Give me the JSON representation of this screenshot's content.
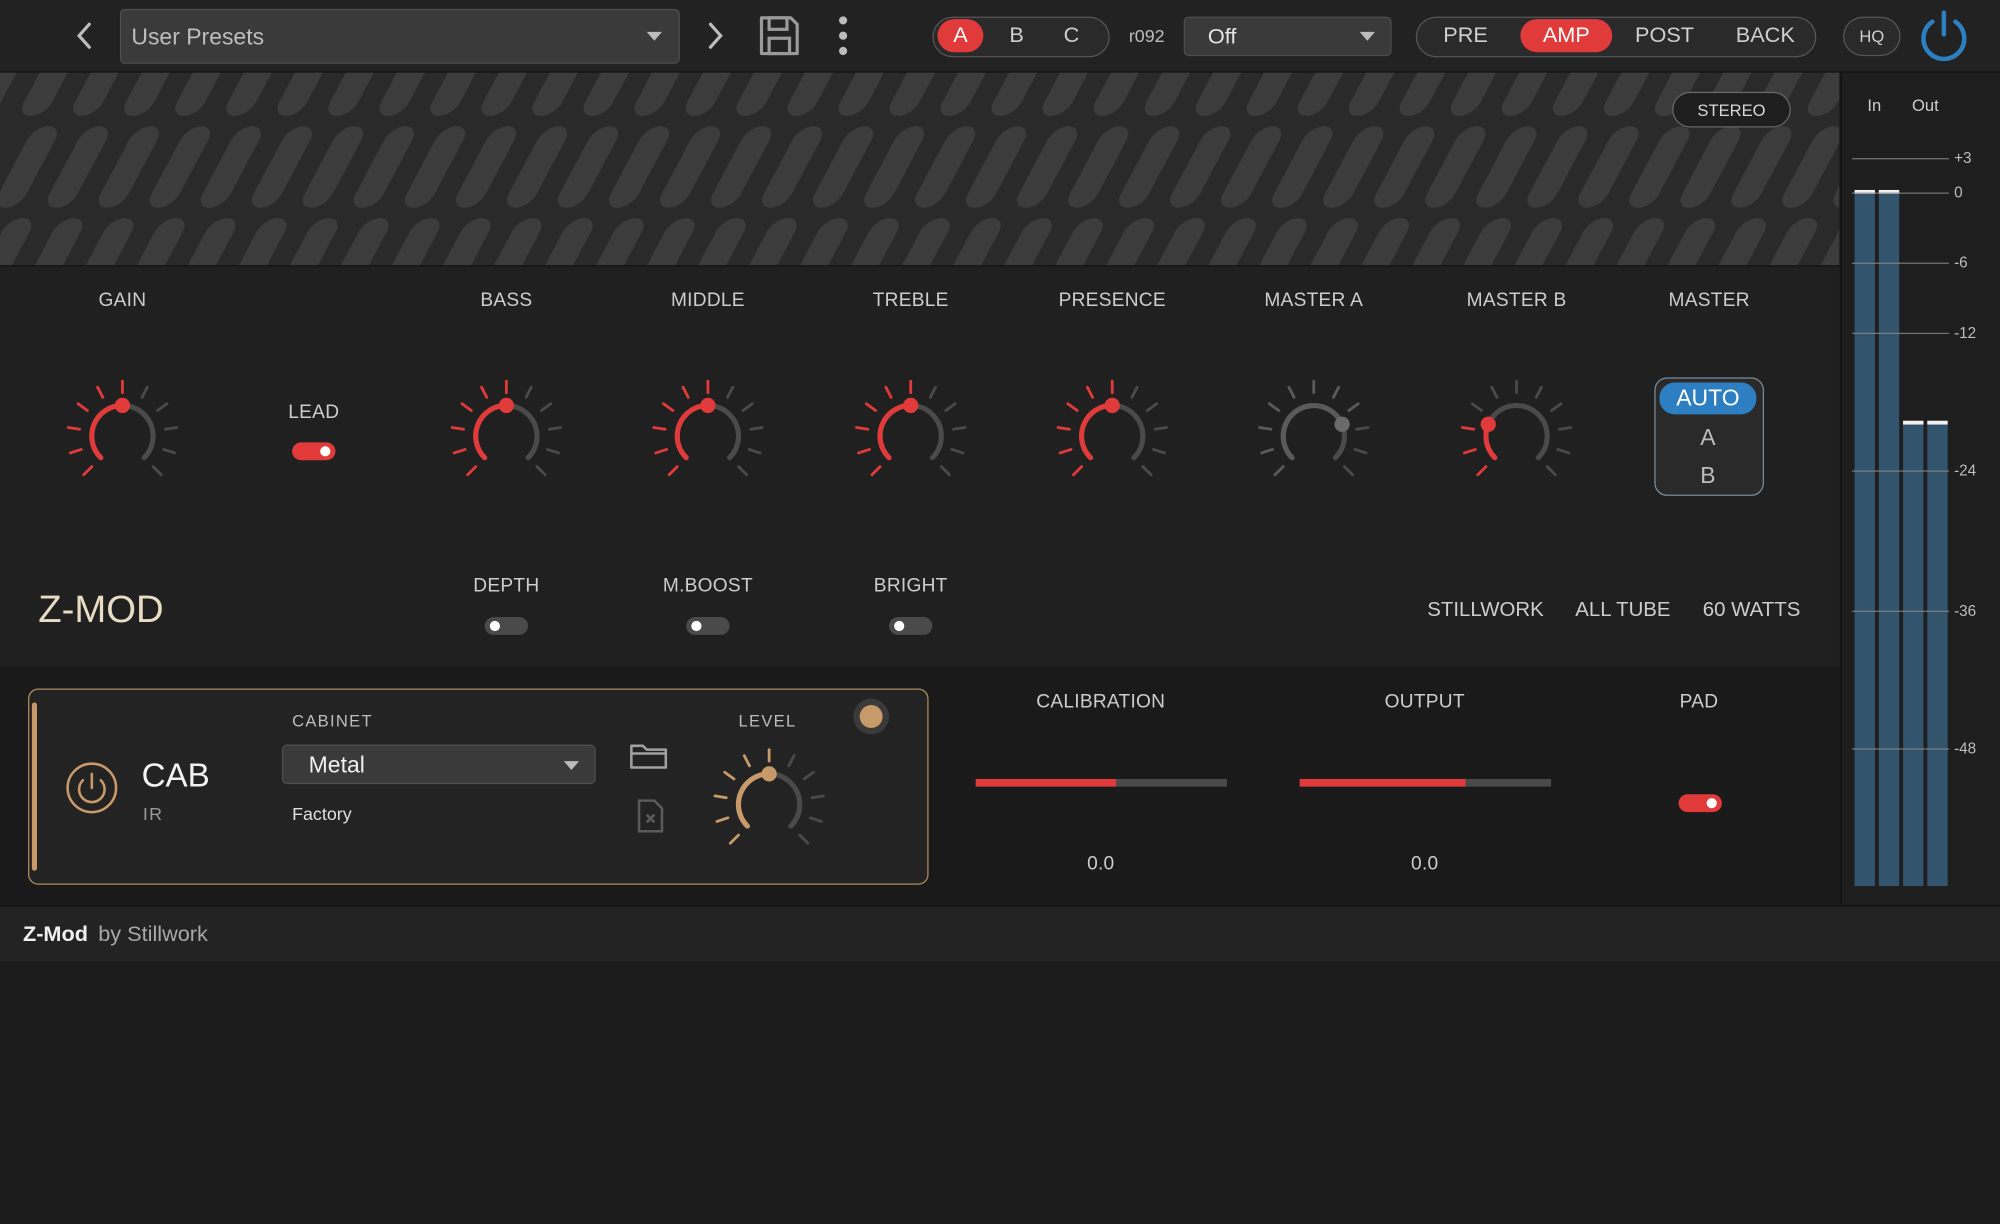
{
  "colors": {
    "accent_red": "#e03a3a",
    "accent_blue": "#2d7fc1",
    "cab_gold": "#c89a6a"
  },
  "topbar": {
    "preset_label": "User Presets",
    "snapshots": [
      "A",
      "B",
      "C"
    ],
    "snapshot_selected": "A",
    "version": "r092",
    "mode_value": "Off",
    "sections": [
      "PRE",
      "AMP",
      "POST",
      "BACK"
    ],
    "section_selected": "AMP",
    "hq_label": "HQ",
    "icons": {
      "prev": "chevron-left-icon",
      "next": "chevron-right-icon",
      "save": "save-icon",
      "menu": "more-vertical-icon",
      "power": "power-icon"
    }
  },
  "hero": {
    "stereo_label": "STEREO"
  },
  "amp": {
    "knobs": [
      {
        "id": "gain",
        "label": "GAIN",
        "value": 0.5
      },
      {
        "id": "bass",
        "label": "BASS",
        "value": 0.5
      },
      {
        "id": "middle",
        "label": "MIDDLE",
        "value": 0.5
      },
      {
        "id": "treble",
        "label": "TREBLE",
        "value": 0.5
      },
      {
        "id": "presence",
        "label": "PRESENCE",
        "value": 0.5
      },
      {
        "id": "master-a",
        "label": "MASTER A",
        "value": 0.75
      },
      {
        "id": "master-b",
        "label": "MASTER B",
        "value": 0.25
      }
    ],
    "lead": {
      "label": "LEAD",
      "on": true
    },
    "master": {
      "label": "MASTER",
      "options": [
        "AUTO",
        "A",
        "B"
      ],
      "selected": "AUTO"
    },
    "switches": [
      {
        "label": "DEPTH",
        "on": false
      },
      {
        "label": "M.BOOST",
        "on": false
      },
      {
        "label": "BRIGHT",
        "on": false
      }
    ],
    "name": "Z-MOD",
    "tags": [
      "STILLWORK",
      "ALL TUBE",
      "60 WATTS"
    ]
  },
  "cab": {
    "title": "CAB",
    "subtitle": "IR",
    "cabinet_label": "CABINET",
    "cabinet_value": "Metal",
    "source": "Factory",
    "level_label": "LEVEL",
    "level_value": 0.5,
    "icons": {
      "power": "power-icon",
      "folder": "folder-icon",
      "clear": "file-clear-icon"
    }
  },
  "output": {
    "calibration": {
      "label": "CALIBRATION",
      "value": "0.0",
      "fill": 0.56
    },
    "output": {
      "label": "OUTPUT",
      "value": "0.0",
      "fill": 0.66
    },
    "pad": {
      "label": "PAD",
      "on": true
    }
  },
  "meters": {
    "in_label": "In",
    "out_label": "Out",
    "scale": [
      "+3",
      "0",
      "-6",
      "-12",
      "-24",
      "-36",
      "-48"
    ]
  },
  "footer": {
    "product": "Z-Mod",
    "by": "by Stillwork"
  }
}
